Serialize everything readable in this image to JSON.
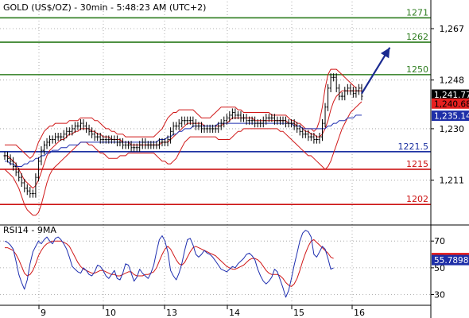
{
  "chart_data": {
    "type": "line",
    "title": "GOLD (US$/OZ) - 30min - 5:48:23 AM (UTC+2)",
    "x_ticks": [
      "9",
      "10",
      "13",
      "14",
      "15",
      "16"
    ],
    "price_panel": {
      "ylim": [
        1195,
        1277
      ],
      "y_ticks": [
        1267,
        1248,
        1230,
        1211
      ],
      "price": [
        1220,
        1219,
        1218,
        1216,
        1214,
        1212,
        1210,
        1208,
        1207,
        1206,
        1206,
        1212,
        1218,
        1222,
        1224,
        1225,
        1226,
        1226,
        1227,
        1227,
        1227,
        1228,
        1229,
        1229,
        1230,
        1231,
        1231,
        1232,
        1231,
        1230,
        1229,
        1228,
        1227,
        1227,
        1226,
        1226,
        1226,
        1226,
        1226,
        1226,
        1225,
        1225,
        1224,
        1224,
        1224,
        1223,
        1223,
        1223,
        1224,
        1225,
        1224,
        1224,
        1224,
        1224,
        1224,
        1225,
        1225,
        1225,
        1226,
        1229,
        1231,
        1231,
        1232,
        1233,
        1233,
        1233,
        1233,
        1232,
        1231,
        1231,
        1230,
        1230,
        1230,
        1230,
        1230,
        1230,
        1231,
        1232,
        1233,
        1234,
        1235,
        1236,
        1235,
        1235,
        1234,
        1234,
        1233,
        1233,
        1233,
        1232,
        1232,
        1232,
        1233,
        1234,
        1234,
        1234,
        1233,
        1233,
        1233,
        1233,
        1232,
        1232,
        1232,
        1231,
        1230,
        1229,
        1228,
        1228,
        1227,
        1227,
        1226,
        1226,
        1227,
        1232,
        1238,
        1245,
        1249,
        1249,
        1245,
        1242,
        1242,
        1244,
        1245,
        1244,
        1243,
        1244,
        1245,
        1242
      ],
      "ma_blue": [
        1218,
        1218,
        1217,
        1217,
        1216,
        1216,
        1216,
        1217,
        1217,
        1218,
        1218,
        1219,
        1219,
        1220,
        1220,
        1221,
        1221,
        1222,
        1222,
        1222,
        1223,
        1223,
        1223,
        1224,
        1224,
        1224,
        1224,
        1225,
        1225,
        1225,
        1225,
        1225,
        1225,
        1225,
        1225,
        1225,
        1225,
        1225,
        1225,
        1225,
        1225,
        1225,
        1225,
        1225,
        1225,
        1225,
        1225,
        1225,
        1225,
        1225,
        1225,
        1225,
        1225,
        1225,
        1225,
        1226,
        1226,
        1226,
        1227,
        1227,
        1228,
        1228,
        1229,
        1229,
        1230,
        1230,
        1230,
        1231,
        1231,
        1231,
        1231,
        1231,
        1231,
        1231,
        1231,
        1231,
        1232,
        1232,
        1232,
        1232,
        1232,
        1232,
        1232,
        1232,
        1232,
        1232,
        1232,
        1232,
        1232,
        1232,
        1232,
        1232,
        1232,
        1232,
        1232,
        1232,
        1232,
        1232,
        1232,
        1232,
        1232,
        1232,
        1232,
        1231,
        1231,
        1231,
        1230,
        1230,
        1230,
        1230,
        1230,
        1230,
        1230,
        1230,
        1230,
        1231,
        1231,
        1232,
        1232,
        1233,
        1233,
        1233,
        1234,
        1234,
        1234,
        1235,
        1235,
        1235
      ],
      "ma_red": [
        1220,
        1220,
        1219,
        1218,
        1217,
        1215,
        1213,
        1211,
        1210,
        1209,
        1208,
        1209,
        1211,
        1214,
        1217,
        1220,
        1222,
        1223,
        1224,
        1225,
        1226,
        1226,
        1227,
        1228,
        1228,
        1229,
        1229,
        1230,
        1230,
        1230,
        1230,
        1229,
        1229,
        1228,
        1228,
        1227,
        1227,
        1227,
        1226,
        1226,
        1226,
        1226,
        1225,
        1225,
        1225,
        1224,
        1224,
        1224,
        1224,
        1224,
        1224,
        1224,
        1224,
        1224,
        1224,
        1224,
        1225,
        1225,
        1225,
        1226,
        1227,
        1228,
        1229,
        1230,
        1231,
        1232,
        1232,
        1232,
        1232,
        1232,
        1232,
        1231,
        1231,
        1231,
        1231,
        1231,
        1231,
        1231,
        1232,
        1232,
        1233,
        1234,
        1234,
        1234,
        1234,
        1234,
        1234,
        1234,
        1234,
        1233,
        1233,
        1233,
        1233,
        1233,
        1233,
        1233,
        1233,
        1233,
        1233,
        1233,
        1233,
        1232,
        1232,
        1232,
        1231,
        1231,
        1230,
        1229,
        1229,
        1228,
        1228,
        1227,
        1227,
        1228,
        1230,
        1233,
        1237,
        1240,
        1242,
        1243,
        1244,
        1244,
        1244,
        1244,
        1244,
        1244,
        1244,
        1244
      ],
      "band_upper": [
        1224,
        1224,
        1224,
        1224,
        1224,
        1223,
        1222,
        1221,
        1220,
        1219,
        1220,
        1222,
        1225,
        1227,
        1229,
        1230,
        1231,
        1231,
        1232,
        1232,
        1232,
        1232,
        1232,
        1233,
        1233,
        1233,
        1233,
        1234,
        1234,
        1234,
        1234,
        1234,
        1233,
        1233,
        1232,
        1231,
        1230,
        1230,
        1229,
        1229,
        1228,
        1228,
        1228,
        1227,
        1227,
        1227,
        1227,
        1227,
        1227,
        1227,
        1227,
        1227,
        1227,
        1227,
        1228,
        1229,
        1230,
        1232,
        1234,
        1235,
        1236,
        1236,
        1237,
        1237,
        1237,
        1237,
        1237,
        1237,
        1236,
        1235,
        1234,
        1234,
        1234,
        1234,
        1235,
        1236,
        1237,
        1238,
        1238,
        1238,
        1238,
        1238,
        1238,
        1237,
        1237,
        1236,
        1236,
        1236,
        1236,
        1236,
        1236,
        1236,
        1236,
        1236,
        1236,
        1235,
        1235,
        1235,
        1235,
        1235,
        1235,
        1234,
        1233,
        1233,
        1232,
        1232,
        1231,
        1230,
        1230,
        1230,
        1229,
        1230,
        1233,
        1238,
        1245,
        1250,
        1252,
        1252,
        1252,
        1251,
        1250,
        1249,
        1248,
        1247,
        1246,
        1245
      ],
      "band_lower": [
        1215,
        1214,
        1213,
        1212,
        1210,
        1208,
        1205,
        1202,
        1200,
        1199,
        1198,
        1198,
        1199,
        1202,
        1206,
        1210,
        1213,
        1215,
        1216,
        1217,
        1218,
        1219,
        1220,
        1221,
        1222,
        1223,
        1224,
        1225,
        1225,
        1225,
        1224,
        1224,
        1223,
        1222,
        1221,
        1221,
        1220,
        1219,
        1219,
        1219,
        1219,
        1220,
        1220,
        1220,
        1221,
        1221,
        1221,
        1221,
        1221,
        1221,
        1221,
        1221,
        1221,
        1221,
        1220,
        1219,
        1218,
        1218,
        1217,
        1217,
        1218,
        1219,
        1221,
        1223,
        1225,
        1226,
        1227,
        1227,
        1227,
        1227,
        1227,
        1227,
        1227,
        1227,
        1227,
        1227,
        1226,
        1226,
        1226,
        1226,
        1226,
        1227,
        1228,
        1229,
        1229,
        1230,
        1230,
        1230,
        1230,
        1230,
        1230,
        1230,
        1230,
        1230,
        1230,
        1230,
        1230,
        1230,
        1229,
        1229,
        1228,
        1227,
        1226,
        1225,
        1224,
        1223,
        1222,
        1221,
        1220,
        1220,
        1219,
        1218,
        1217,
        1216,
        1215,
        1216,
        1218,
        1221,
        1224,
        1227,
        1230,
        1232,
        1234,
        1236,
        1237,
        1238,
        1239,
        1240
      ],
      "levels": [
        {
          "label": "1271",
          "value": 1271,
          "color": "#2e7d1f",
          "label_color": "#2e7d1f"
        },
        {
          "label": "1262",
          "value": 1262,
          "color": "#2e7d1f",
          "label_color": "#2e7d1f"
        },
        {
          "label": "1250",
          "value": 1250,
          "color": "#2e7d1f",
          "label_color": "#2e7d1f"
        },
        {
          "label": "1221.5",
          "value": 1221.5,
          "color": "#1a2fa0",
          "label_color": "#1a2fa0"
        },
        {
          "label": "1215",
          "value": 1215,
          "color": "#cc1111",
          "label_color": "#cc1111"
        },
        {
          "label": "1202",
          "value": 1202,
          "color": "#cc1111",
          "label_color": "#cc1111"
        }
      ],
      "price_tags": [
        {
          "label": "1,241.77",
          "value": 1242.6,
          "bg": "#000000",
          "fg": "#ffffff"
        },
        {
          "label": "1,240.68",
          "value": 1239.3,
          "bg": "#e62020",
          "fg": "#000000"
        },
        {
          "label": "1,235.14",
          "value": 1234.8,
          "bg": "#1e2fa8",
          "fg": "#ffffff"
        }
      ],
      "forecast_arrow": {
        "x_from": 127,
        "y_from": 1243,
        "x_to": 137,
        "y_to": 1260
      }
    },
    "rsi_panel": {
      "label": "RSI14 - 9MA",
      "ylim": [
        22,
        82
      ],
      "y_ticks": [
        70,
        50,
        30
      ],
      "rsi": [
        70,
        69,
        67,
        64,
        55,
        45,
        39,
        34,
        41,
        53,
        62,
        66,
        70,
        68,
        71,
        73,
        70,
        68,
        72,
        73,
        71,
        68,
        64,
        58,
        51,
        49,
        47,
        46,
        50,
        48,
        45,
        44,
        47,
        52,
        51,
        48,
        44,
        42,
        45,
        48,
        42,
        41,
        46,
        53,
        52,
        46,
        40,
        43,
        49,
        46,
        44,
        42,
        46,
        52,
        62,
        71,
        74,
        70,
        62,
        48,
        44,
        41,
        46,
        53,
        63,
        71,
        72,
        67,
        60,
        58,
        60,
        63,
        61,
        60,
        58,
        55,
        52,
        49,
        48,
        47,
        49,
        51,
        50,
        53,
        55,
        57,
        60,
        61,
        59,
        56,
        49,
        44,
        40,
        38,
        40,
        43,
        49,
        47,
        41,
        35,
        28,
        33,
        42,
        52,
        61,
        70,
        76,
        78,
        77,
        73,
        60,
        58,
        62,
        66,
        64,
        57,
        49,
        50
      ],
      "ma": [
        65,
        65,
        64,
        63,
        60,
        56,
        51,
        46,
        44,
        45,
        48,
        53,
        59,
        63,
        66,
        68,
        69,
        70,
        70,
        70,
        70,
        69,
        68,
        66,
        62,
        58,
        54,
        51,
        49,
        48,
        47,
        46,
        46,
        47,
        48,
        48,
        47,
        46,
        45,
        45,
        44,
        44,
        45,
        46,
        47,
        47,
        45,
        44,
        44,
        44,
        45,
        45,
        46,
        47,
        50,
        55,
        60,
        64,
        66,
        64,
        60,
        56,
        53,
        52,
        54,
        58,
        62,
        65,
        66,
        65,
        64,
        63,
        62,
        61,
        60,
        59,
        57,
        55,
        53,
        51,
        50,
        49,
        49,
        50,
        51,
        52,
        54,
        56,
        57,
        57,
        56,
        54,
        51,
        48,
        46,
        45,
        45,
        45,
        44,
        42,
        39,
        37,
        36,
        38,
        42,
        48,
        55,
        61,
        66,
        70,
        71,
        69,
        67,
        65,
        63,
        61,
        58,
        57
      ],
      "tags": [
        {
          "label": "57.3189",
          "value": 57.3189,
          "bg": "#e62020",
          "fg": "#000000"
        },
        {
          "label": "55.7898",
          "value": 55.7898,
          "bg": "#1e2fa8",
          "fg": "#ffffff"
        }
      ]
    },
    "colors": {
      "price": "#000000",
      "ma_blue": "#1f2fb0",
      "ma_red": "#d01818",
      "bands": "#d01818",
      "rsi": "#1f2fb0",
      "rsi_ma": "#d01818",
      "grid": "#9a9a9a",
      "arrow": "#1a2a90"
    },
    "grid": true
  }
}
